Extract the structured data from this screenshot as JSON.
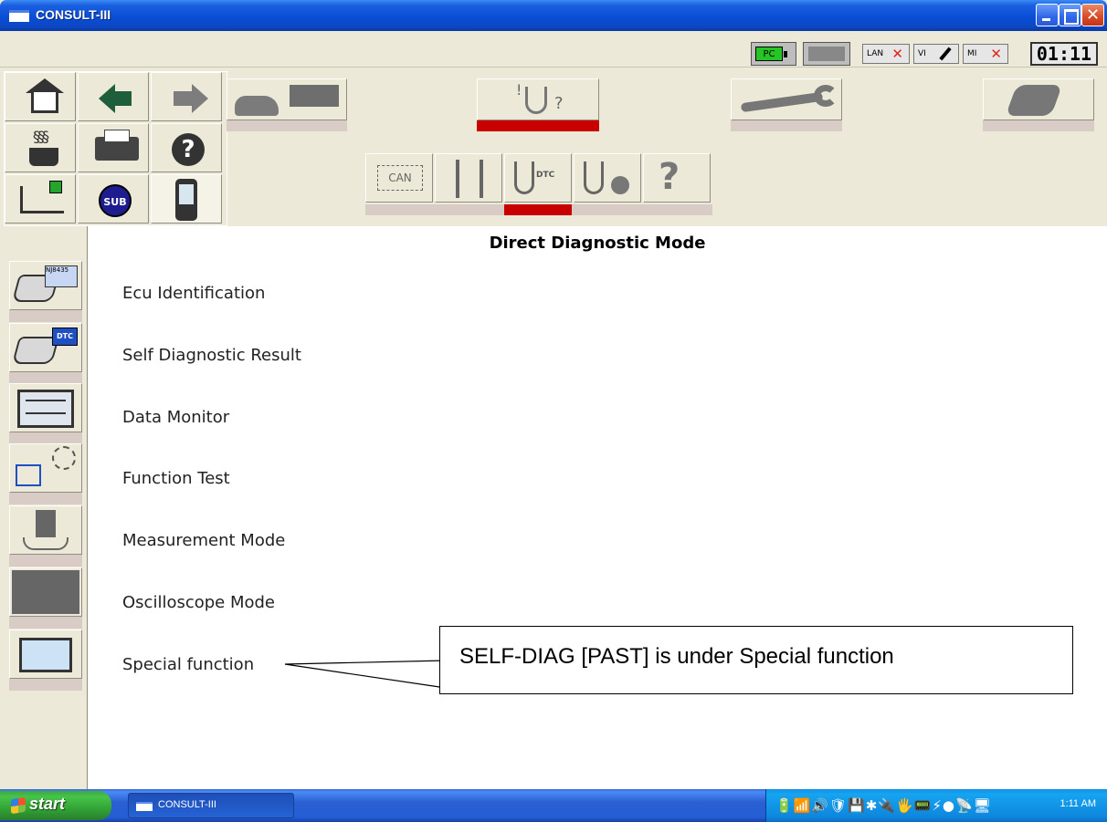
{
  "window": {
    "title": "CONSULT-III",
    "close_glyph": "✕"
  },
  "status": {
    "pc_label": "PC",
    "lan_label": "LAN",
    "vi_label": "VI",
    "mi_label": "MI",
    "clock": "01:11"
  },
  "toolbar": {
    "home": "home-icon",
    "back": "back-arrow-icon",
    "forward": "forward-arrow-icon",
    "break": "coffee-cup-icon",
    "print": "printer-icon",
    "help_glyph": "?",
    "flow": "flowchart-icon",
    "sub_label": "SUB",
    "device": "device-icon"
  },
  "mode_buttons": [
    {
      "name": "vehicle-connect-icon",
      "active": false
    },
    {
      "name": "diagnosis-icon",
      "active": true
    },
    {
      "name": "repair-wrench-icon",
      "active": false
    },
    {
      "name": "tools-icon",
      "active": false
    }
  ],
  "sub_tabs": [
    {
      "name": "can-tab",
      "label": "CAN",
      "active": false
    },
    {
      "name": "flow-tab",
      "label": "",
      "active": false
    },
    {
      "name": "dtc-tab",
      "label": "DTC",
      "active": true
    },
    {
      "name": "ecu-tab",
      "label": "",
      "active": false
    },
    {
      "name": "help-diag-tab",
      "label": "?",
      "active": false
    }
  ],
  "sidebar": [
    {
      "name": "ecu-identification-icon",
      "card_text": "NJ8435"
    },
    {
      "name": "self-diagnostic-result-icon",
      "card_text": "DTC"
    },
    {
      "name": "data-monitor-icon",
      "card_text": ""
    },
    {
      "name": "function-test-icon",
      "card_text": ""
    },
    {
      "name": "measurement-mode-icon",
      "card_text": ""
    },
    {
      "name": "oscilloscope-mode-icon",
      "card_text": ""
    },
    {
      "name": "special-function-icon",
      "card_text": ""
    }
  ],
  "main": {
    "title": "Direct Diagnostic Mode",
    "menu": [
      "Ecu Identification",
      "Self Diagnostic Result",
      "Data Monitor",
      "Function Test",
      "Measurement Mode",
      "Oscilloscope Mode",
      "Special function"
    ]
  },
  "callout": {
    "text": "SELF-DIAG [PAST] is under Special function"
  },
  "taskbar": {
    "start_label": "start",
    "task_label": "CONSULT-III",
    "tray_icons": "🔋📶🔊🛡💾✱🔌🖐📟⚡●📡🖥",
    "time": "1:11 AM"
  }
}
